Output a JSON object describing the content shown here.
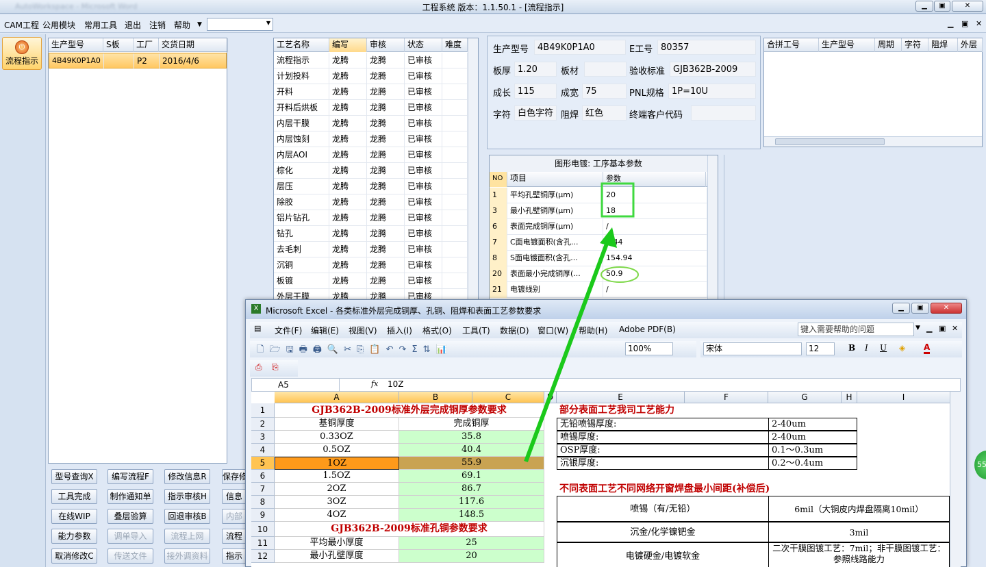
{
  "window": {
    "title": "工程系统  版本：1.1.50.1 - [流程指示]",
    "blurred_title": "AutoWorkspace - Microsoft Word"
  },
  "menu": {
    "items": [
      "CAM工程",
      "公用模块",
      "常用工具",
      "退出",
      "注销",
      "帮助"
    ]
  },
  "nav": {
    "button_label": "流程指示"
  },
  "orders": {
    "columns": [
      "生产型号",
      "S板",
      "工厂",
      "交货日期"
    ],
    "rows": [
      [
        "4B49K0P1A0",
        "",
        "P2",
        "2016/4/6"
      ]
    ]
  },
  "process": {
    "columns": [
      "工艺名称",
      "编写",
      "审核",
      "状态",
      "难度"
    ],
    "rows": [
      [
        "流程指示",
        "龙腾",
        "龙腾",
        "已审核"
      ],
      [
        "计划投料",
        "龙腾",
        "龙腾",
        "已审核"
      ],
      [
        "开料",
        "龙腾",
        "龙腾",
        "已审核"
      ],
      [
        "开料后烘板",
        "龙腾",
        "龙腾",
        "已审核"
      ],
      [
        "内层干膜",
        "龙腾",
        "龙腾",
        "已审核"
      ],
      [
        "内层蚀刻",
        "龙腾",
        "龙腾",
        "已审核"
      ],
      [
        "内层AOI",
        "龙腾",
        "龙腾",
        "已审核"
      ],
      [
        "棕化",
        "龙腾",
        "龙腾",
        "已审核"
      ],
      [
        "层压",
        "龙腾",
        "龙腾",
        "已审核"
      ],
      [
        "除胶",
        "龙腾",
        "龙腾",
        "已审核"
      ],
      [
        "铝片钻孔",
        "龙腾",
        "龙腾",
        "已审核"
      ],
      [
        "钻孔",
        "龙腾",
        "龙腾",
        "已审核"
      ],
      [
        "去毛刺",
        "龙腾",
        "龙腾",
        "已审核"
      ],
      [
        "沉铜",
        "龙腾",
        "龙腾",
        "已审核"
      ],
      [
        "板镀",
        "龙腾",
        "龙腾",
        "已审核"
      ],
      [
        "外层干膜",
        "龙腾",
        "龙腾",
        "已审核"
      ]
    ]
  },
  "info": {
    "prod_model_label": "生产型号",
    "prod_model": "4B49K0P1A0",
    "eno_label": "E工号",
    "eno": "80357",
    "thick_label": "板厚",
    "thick": "1.20",
    "mat_label": "板材",
    "mat": "",
    "std_label": "验收标准",
    "std": "GJB362B-2009",
    "len_label": "成长",
    "len": "115",
    "wid_label": "成宽",
    "wid": "75",
    "pnl_label": "PNL规格",
    "pnl": "1P=10U",
    "char_label": "字符",
    "char": "白色字符",
    "mask_label": "阻焊",
    "mask": "红色",
    "cust_label": "终端客户代码",
    "cust": ""
  },
  "merge": {
    "columns": [
      "合拼工号",
      "生产型号",
      "周期",
      "字符",
      "阻焊",
      "外层"
    ]
  },
  "params": {
    "title": "图形电镀: 工序基本参数",
    "columns": [
      "NO",
      "项目",
      "参数"
    ],
    "rows": [
      [
        "1",
        "平均孔壁铜厚(μm)",
        "20"
      ],
      [
        "3",
        "最小孔壁铜厚(μm)",
        "18"
      ],
      [
        "6",
        "表面完成铜厚(μm)",
        "/"
      ],
      [
        "7",
        "C面电镀面积(含孔...",
        "7.44"
      ],
      [
        "8",
        "S面电镀面积(含孔...",
        "154.94"
      ],
      [
        "20",
        "表面最小完成铜厚(...",
        "50.9"
      ],
      [
        "21",
        "电镀线别",
        "/"
      ]
    ]
  },
  "buttons": [
    [
      "型号查询X",
      "编写流程F",
      "修改信息R",
      "保存修"
    ],
    [
      "工具完成",
      "制作通知单",
      "指示审核H",
      "信息"
    ],
    [
      "在线WIP",
      "叠层验算",
      "回退审核B",
      "内部"
    ],
    [
      "能力参数",
      "调单导入",
      "流程上网",
      "流程"
    ],
    [
      "取消修改C",
      "传送文件",
      "接外调资料",
      "指示"
    ]
  ],
  "disabled_buttons": [
    "调单导入",
    "流程上网",
    "传送文件",
    "接外调资料",
    "内部"
  ],
  "excel": {
    "title": "Microsoft Excel - 各类标准外层完成铜厚、孔铜、阻焊和表面工艺参数要求",
    "menus": [
      "文件(F)",
      "编辑(E)",
      "视图(V)",
      "插入(I)",
      "格式(O)",
      "工具(T)",
      "数据(D)",
      "窗口(W)",
      "帮助(H)",
      "Adobe PDF(B)"
    ],
    "help_placeholder": "键入需要帮助的问题",
    "zoom": "100%",
    "font": "宋体",
    "size": "12",
    "cellref": "A5",
    "fx": "fx",
    "formula": "10Z",
    "cols": [
      "A",
      "B",
      "C",
      "D",
      "E",
      "F",
      "G",
      "H",
      "I"
    ],
    "left_title": "GJB362B-2009标准外层完成铜厚参数要求",
    "hdr1": "基铜厚度",
    "hdr2": "完成铜厚",
    "rows": [
      [
        "0.33OZ",
        "35.8"
      ],
      [
        "0.5OZ",
        "40.4"
      ],
      [
        "1OZ",
        "55.9"
      ],
      [
        "1.5OZ",
        "69.1"
      ],
      [
        "2OZ",
        "86.7"
      ],
      [
        "3OZ",
        "117.6"
      ],
      [
        "4OZ",
        "148.5"
      ]
    ],
    "left_title2": "GJB362B-2009标准孔铜参数要求",
    "r11a": "平均最小厚度",
    "r11b": "25",
    "r12a": "最小孔壁厚度",
    "r12b": "20",
    "right_title": "部分表面工艺我司工艺能力",
    "surf": [
      [
        "无铅喷锡厚度:",
        "2-40um"
      ],
      [
        "喷锡厚度:",
        "2-40um"
      ],
      [
        "OSP厚度:",
        "0.1～0.3um"
      ],
      [
        "沉银厚度:",
        "0.2～0.4um"
      ]
    ],
    "right_title2": "不同表面工艺不同网络开窗焊盘最小间距(补偿后)",
    "gap": [
      [
        "喷锡（有/无铅）",
        "6mil（大铜皮内焊盘隔离10mil）"
      ],
      [
        "沉金/化学镍钯金",
        "3mil"
      ],
      [
        "电镀硬金/电镀软金",
        "二次干膜图镀工艺：7mil；非干膜图镀工艺：参照线路能力"
      ]
    ],
    "row_nums": [
      "1",
      "2",
      "3",
      "4",
      "5",
      "6",
      "7",
      "8",
      "9",
      "10",
      "11",
      "12"
    ]
  },
  "badge": "55"
}
